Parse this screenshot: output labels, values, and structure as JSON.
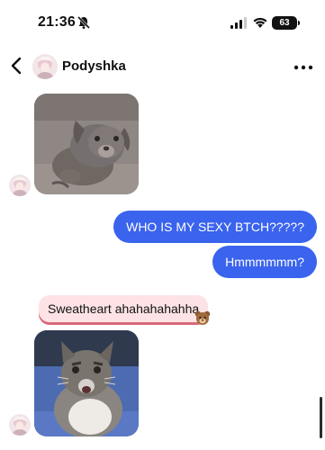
{
  "status_bar": {
    "time": "21:36",
    "battery": "63"
  },
  "header": {
    "name": "Podyshka"
  },
  "messages": [
    {
      "type": "image",
      "side": "incoming",
      "content": "puppy-photo"
    },
    {
      "type": "text",
      "side": "outgoing",
      "text": "WHO IS MY SEXY BTCH?????"
    },
    {
      "type": "text",
      "side": "outgoing",
      "text": "Hmmmmmm?"
    },
    {
      "type": "text",
      "side": "incoming",
      "text": "Sweatheart ahahahahahha",
      "reaction": "bear-sticker"
    },
    {
      "type": "image",
      "side": "incoming",
      "content": "cat-photo"
    }
  ],
  "colors": {
    "outgoing_bubble": "#3a63ee",
    "incoming_bubble": "#fde3e6",
    "incoming_bubble_shadow": "#d86a78"
  }
}
